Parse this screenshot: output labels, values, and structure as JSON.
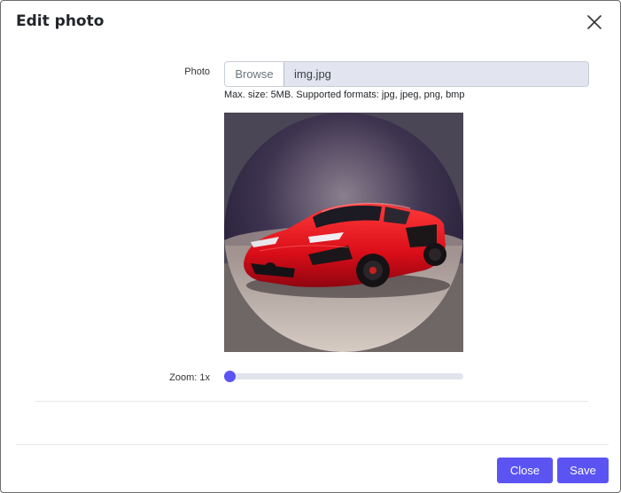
{
  "modal": {
    "title": "Edit photo",
    "close_icon": "close-icon"
  },
  "photo": {
    "label": "Photo",
    "browse_label": "Browse",
    "file_name": "img.jpg",
    "help_text": "Max. size: 5MB. Supported formats: jpg, jpeg, png, bmp"
  },
  "preview": {
    "image": "red sports car on dark background, circular crop"
  },
  "zoom": {
    "label": "Zoom: 1x",
    "value": 0
  },
  "footer": {
    "close_label": "Close",
    "save_label": "Save"
  },
  "colors": {
    "accent": "#5b54f2",
    "input_bg": "#e2e5ef"
  }
}
